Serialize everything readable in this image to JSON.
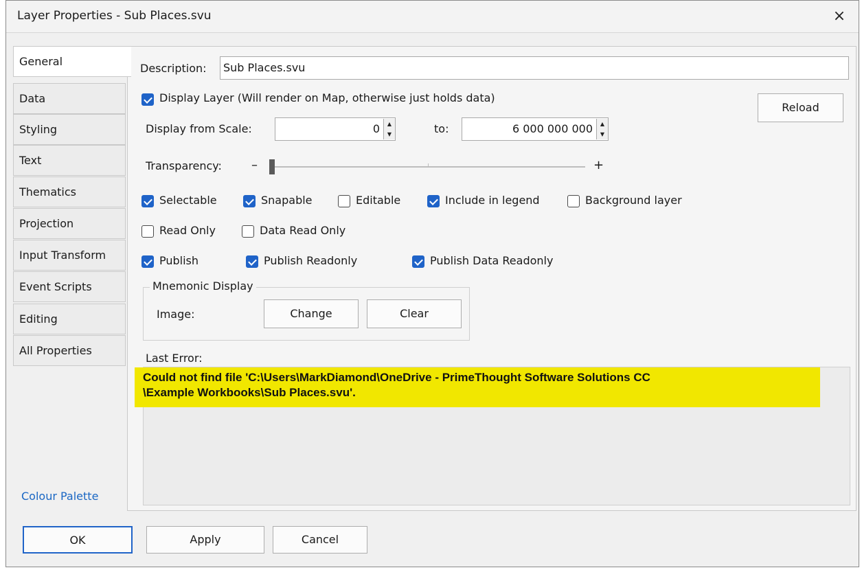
{
  "window": {
    "title": "Layer Properties - Sub Places.svu",
    "close_icon": "×"
  },
  "tabs": [
    {
      "label": "General",
      "active": true
    },
    {
      "label": "Data"
    },
    {
      "label": "Styling"
    },
    {
      "label": "Text"
    },
    {
      "label": "Thematics"
    },
    {
      "label": "Projection"
    },
    {
      "label": "Input Transform"
    },
    {
      "label": "Event Scripts"
    },
    {
      "label": "Editing"
    },
    {
      "label": "All Properties"
    }
  ],
  "colour_palette_link": "Colour Palette",
  "general": {
    "description_label": "Description:",
    "description_value": "Sub Places.svu",
    "display_layer": {
      "checked": true,
      "label": "Display Layer (Will render on Map, otherwise just holds data)"
    },
    "reload_button": "Reload",
    "display_from_scale_label": "Display from Scale:",
    "scale_from": "0",
    "to_label": "to:",
    "scale_to": "6 000 000 000",
    "transparency_label": "Transparency:",
    "transparency_minus": "–",
    "transparency_plus": "+",
    "transparency_value": 0,
    "checkboxes": {
      "selectable": {
        "checked": true,
        "label": "Selectable"
      },
      "snapable": {
        "checked": true,
        "label": "Snapable"
      },
      "editable": {
        "checked": false,
        "label": "Editable"
      },
      "include_in_legend": {
        "checked": true,
        "label": "Include in legend"
      },
      "background_layer": {
        "checked": false,
        "label": "Background layer"
      },
      "read_only": {
        "checked": false,
        "label": "Read Only"
      },
      "data_read_only": {
        "checked": false,
        "label": "Data Read Only"
      },
      "publish": {
        "checked": true,
        "label": "Publish"
      },
      "publish_readonly": {
        "checked": true,
        "label": "Publish Readonly"
      },
      "publish_data_readonly": {
        "checked": true,
        "label": "Publish Data Readonly"
      }
    },
    "mnemonic": {
      "group_title": "Mnemonic Display",
      "image_label": "Image:",
      "change_button": "Change",
      "clear_button": "Clear"
    },
    "last_error_label": "Last Error:",
    "last_error_line1": "Could not find file 'C:\\Users\\MarkDiamond\\OneDrive - PrimeThought Software Solutions CC",
    "last_error_line2": "\\Example Workbooks\\Sub Places.svu'."
  },
  "footer": {
    "ok": "OK",
    "apply": "Apply",
    "cancel": "Cancel"
  },
  "colors": {
    "accent": "#1f63c8",
    "error_highlight": "#f1e700",
    "link": "#1a67c4"
  }
}
